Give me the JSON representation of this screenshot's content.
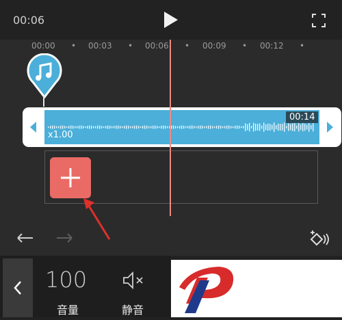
{
  "player": {
    "current_time": "00:06",
    "play_icon": "play-icon",
    "fullscreen_icon": "fullscreen-icon"
  },
  "ruler": {
    "ticks": [
      "00:00",
      "00:03",
      "00:06",
      "00:09",
      "00:12"
    ]
  },
  "audio_track": {
    "marker_icon": "music-note-icon",
    "duration": "00:14",
    "speed": "x1.00",
    "color": "#4bafd9"
  },
  "add_button": {
    "icon": "plus-icon",
    "color": "#ea6b66"
  },
  "toolbar": {
    "undo_icon": "undo-icon",
    "redo_icon": "redo-icon",
    "fx_icon": "keyframe-icon"
  },
  "bottom_panel": {
    "volume_value": "100",
    "volume_label": "音量",
    "mute_label": "静音",
    "back_icon": "chevron-left-icon"
  }
}
